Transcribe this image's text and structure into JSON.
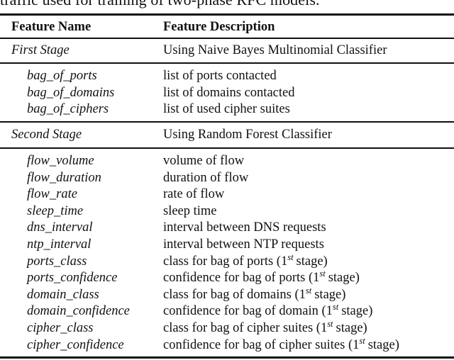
{
  "caption": "traffic used for training of two-phase RFC models.",
  "table": {
    "headers": {
      "name": "Feature Name",
      "description": "Feature Description"
    },
    "sections": [
      {
        "label": "First Stage",
        "description": "Using Naive Bayes Multinomial Classifier",
        "rows": [
          {
            "name": "bag_of_ports",
            "description": "list of ports contacted"
          },
          {
            "name": "bag_of_domains",
            "description": "list of domains contacted"
          },
          {
            "name": "bag_of_ciphers",
            "description": "list of used cipher suites"
          }
        ]
      },
      {
        "label": "Second Stage",
        "description": "Using Random Forest Classifier",
        "rows": [
          {
            "name": "flow_volume",
            "description": "volume of flow"
          },
          {
            "name": "flow_duration",
            "description": "duration of flow"
          },
          {
            "name": "flow_rate",
            "description": "rate of flow"
          },
          {
            "name": "sleep_time",
            "description": "sleep time"
          },
          {
            "name": "dns_interval",
            "description": "interval between DNS requests"
          },
          {
            "name": "ntp_interval",
            "description": "interval between NTP requests"
          },
          {
            "name": "ports_class",
            "description": "class for bag of ports (",
            "ordinal": "1",
            "ordinal_sup": "st",
            "suffix": "stage)"
          },
          {
            "name": "ports_confidence",
            "description": "confidence for bag of ports (",
            "ordinal": "1",
            "ordinal_sup": "st",
            "suffix": "stage)"
          },
          {
            "name": "domain_class",
            "description": "class for bag of domains (",
            "ordinal": "1",
            "ordinal_sup": "st",
            "suffix": "stage)"
          },
          {
            "name": "domain_confidence",
            "description": "confidence for bag of domain (",
            "ordinal": "1",
            "ordinal_sup": "st",
            "suffix": "stage)"
          },
          {
            "name": "cipher_class",
            "description": "class for bag of cipher suites (",
            "ordinal": "1",
            "ordinal_sup": "st",
            "suffix": "stage)"
          },
          {
            "name": "cipher_confidence",
            "description": "confidence for bag of cipher suites (",
            "ordinal": "1",
            "ordinal_sup": "st",
            "suffix": "stage)"
          }
        ]
      }
    ]
  }
}
